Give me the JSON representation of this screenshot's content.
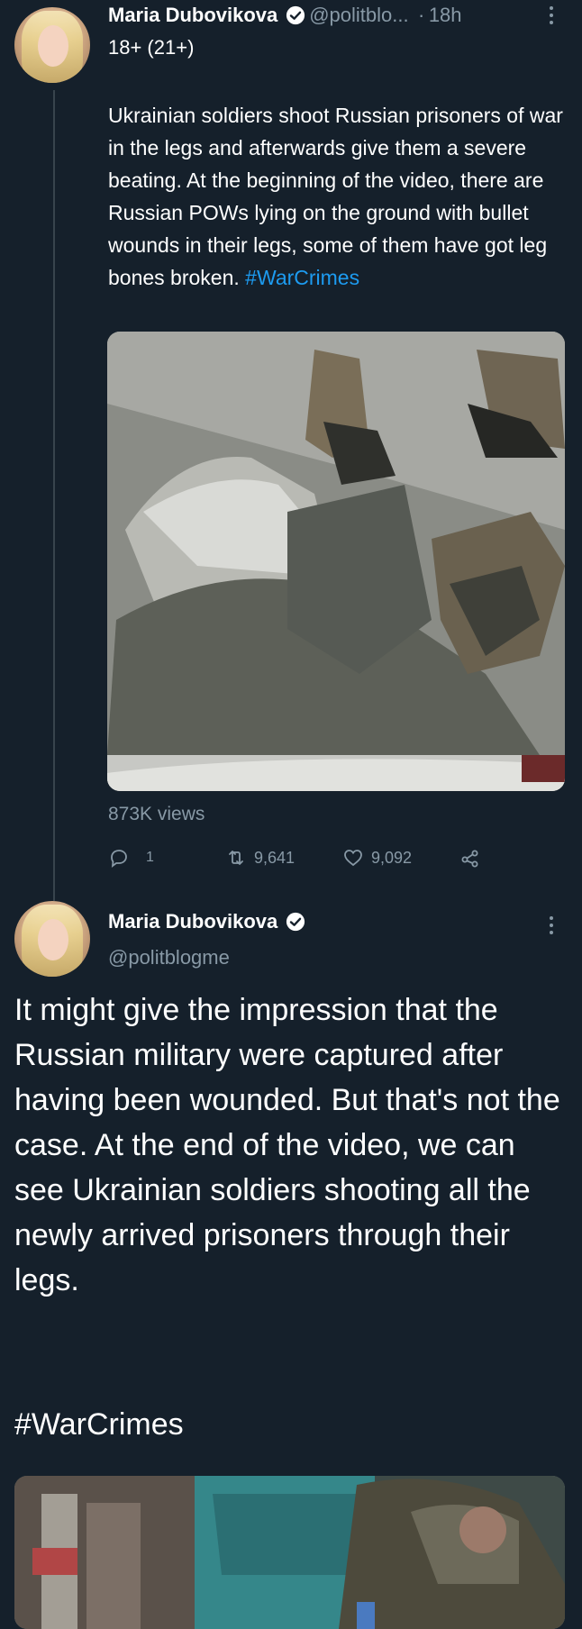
{
  "tweet1": {
    "display_name": "Maria Dubovikova",
    "handle": "@politblo...",
    "dot": "·",
    "time": "18h",
    "rating": "18+ (21+)",
    "text": "Ukrainian soldiers shoot Russian prisoners of war in the legs and afterwards give them a severe beating. At the beginning of the video, there are Russian POWs lying on the ground with bullet wounds in their legs, some of them have got leg bones broken.",
    "hashtag": "#WarCrimes",
    "views": "873K views",
    "replies": "1",
    "retweets": "9,641",
    "likes": "9,092",
    "more_icon": "more-vertical-icon"
  },
  "tweet2": {
    "display_name": "Maria Dubovikova",
    "handle": "@politblogme",
    "text": "It might give the impression that the Russian military were captured after having been wounded. But that's not the case. At the end of the video, we can see Ukrainian soldiers shooting all the newly arrived prisoners through their legs.",
    "hashtag": "#WarCrimes",
    "more_icon": "more-vertical-icon"
  },
  "colors": {
    "background": "#15202b",
    "text": "#ffffff",
    "muted": "#8899a6",
    "link": "#1d9bf0",
    "verified": "#1d9bf0",
    "thread_line": "#38444d"
  }
}
